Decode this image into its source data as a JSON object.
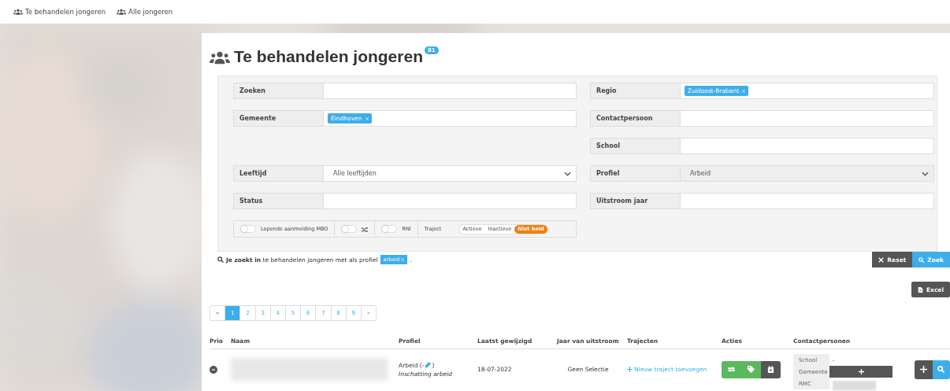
{
  "nav": [
    {
      "label": "Te behandelen jongeren"
    },
    {
      "label": "Alle jongeren"
    }
  ],
  "header": {
    "title": "Te behandelen jongeren",
    "count": "81"
  },
  "filter_rows": [
    {
      "left": {
        "label": "Zoeken",
        "kind": "text"
      },
      "right": {
        "label": "Regio",
        "kind": "tags",
        "tags": [
          "Zuidoost-Brabant"
        ]
      }
    },
    {
      "left": {
        "label": "Gemeente",
        "kind": "tags",
        "tags": [
          "Eindhoven"
        ]
      },
      "right": {
        "label": "Contactpersoon",
        "kind": "text"
      }
    },
    {
      "right": {
        "label": "School",
        "kind": "text"
      }
    },
    {
      "left": {
        "label": "Leeftijd",
        "kind": "select",
        "value": "Alle leeftijden",
        "disabled": false
      },
      "right": {
        "label": "Profiel",
        "kind": "select",
        "value": "Arbeid",
        "disabled": true
      }
    },
    {
      "left": {
        "label": "Status",
        "kind": "text"
      },
      "right": {
        "label": "Uitstroom jaar",
        "kind": "text"
      }
    }
  ],
  "toggles": [
    {
      "kind": "switch",
      "label": "Lopende aanmelding MBO",
      "on": false
    },
    {
      "kind": "switch-icon",
      "on": false
    },
    {
      "kind": "switch",
      "label": "RNI",
      "on": false
    },
    {
      "kind": "segmented",
      "label": "Traject",
      "options": [
        {
          "label": "Actieve",
          "selected": false
        },
        {
          "label": "Inactieve",
          "selected": false
        },
        {
          "label": "Niet beid",
          "selected": true
        }
      ]
    }
  ],
  "search_summary": {
    "prefix": "Je zoekt in",
    "text": "te behandelen jongeren met als profiel",
    "tag": "arbeid",
    "suffix": "."
  },
  "actions": [
    {
      "kind": "reset",
      "label": "Reset"
    },
    {
      "kind": "search",
      "label": "Zoek"
    }
  ],
  "export": {
    "label": "Excel"
  },
  "pagination": [
    {
      "label": "«",
      "selected": false
    },
    {
      "label": "1",
      "selected": true
    },
    {
      "label": "2",
      "selected": false
    },
    {
      "label": "3",
      "selected": false
    },
    {
      "label": "4",
      "selected": false
    },
    {
      "label": "5",
      "selected": false
    },
    {
      "label": "6",
      "selected": false
    },
    {
      "label": "7",
      "selected": false
    },
    {
      "label": "8",
      "selected": false
    },
    {
      "label": "9",
      "selected": false
    },
    {
      "label": "»",
      "selected": false
    }
  ],
  "table": {
    "columns": [
      "Prio",
      "Naam",
      "Profiel",
      "Laatst gewijzigd",
      "Jaar van uitstroom",
      "Trajecten",
      "Acties",
      "Contactpersonen"
    ],
    "rows": [
      {
        "profile": "Arbeid (-",
        "profile_end": ")",
        "assessment": "Inschatting arbeid",
        "modified": "18-07-2022",
        "outflow_year": "Geen Selectie",
        "trajectory_link": "Nieuw traject toevoegen",
        "actions": [
          {
            "kind": "swap"
          },
          {
            "kind": "tag"
          },
          {
            "kind": "calendar"
          }
        ],
        "contacts": [
          {
            "label": "School",
            "kind": "text",
            "value": "-"
          },
          {
            "label": "Gemeente",
            "kind": "add"
          },
          {
            "label": "RMC",
            "kind": "hidden"
          }
        ],
        "row_buttons": [
          {
            "kind": "add"
          },
          {
            "kind": "search"
          }
        ]
      }
    ]
  }
}
